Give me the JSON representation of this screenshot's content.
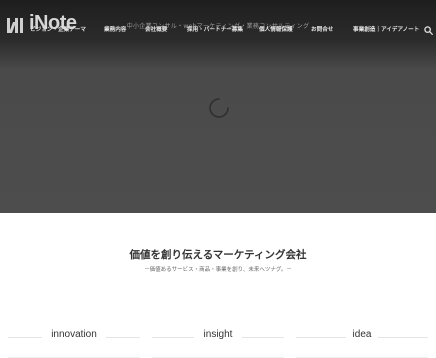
{
  "header": {
    "logo_text": "iNote",
    "tagline": "中小企業コンサル・webマーケティング・業務コンサルティング"
  },
  "nav": {
    "items": [
      "ビジョン・企業テーマ",
      "業務内容",
      "会社概要",
      "採用・パートナー募集",
      "個人情報保護",
      "お問合せ",
      "事業創造｜アイデアノート"
    ]
  },
  "hero": {
    "background_color": "#4d4d4d",
    "loading_icon": "spinner-icon"
  },
  "main": {
    "headline": "価値を創り伝えるマーケティング会社",
    "subline": "－価値あるサービス・商品・事業を創り、未来へツナグ。－",
    "columns": [
      {
        "title": "innovation"
      },
      {
        "title": "insight"
      },
      {
        "title": "idea"
      }
    ]
  }
}
